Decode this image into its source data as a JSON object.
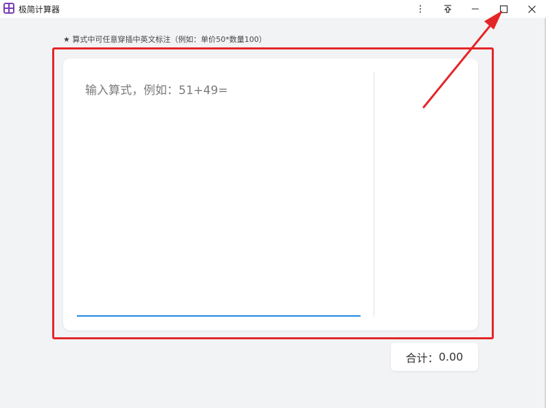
{
  "window": {
    "title": "极简计算器",
    "icons": {
      "app": "calculator-app-icon",
      "more": "more-vertical-icon",
      "pin": "pin-top-icon",
      "minimize": "minimize-icon",
      "maximize": "maximize-icon",
      "close": "close-icon"
    }
  },
  "hint": "★ 算式中可任意穿插中英文标注（例如：单价50*数量100）",
  "input": {
    "value": "",
    "placeholder": "输入算式，例如：51+49="
  },
  "results": [],
  "total": {
    "label": "合计：",
    "value": "0.00"
  },
  "annotation": {
    "highlight_color": "#e42527",
    "accent_color": "#1e88e5"
  }
}
